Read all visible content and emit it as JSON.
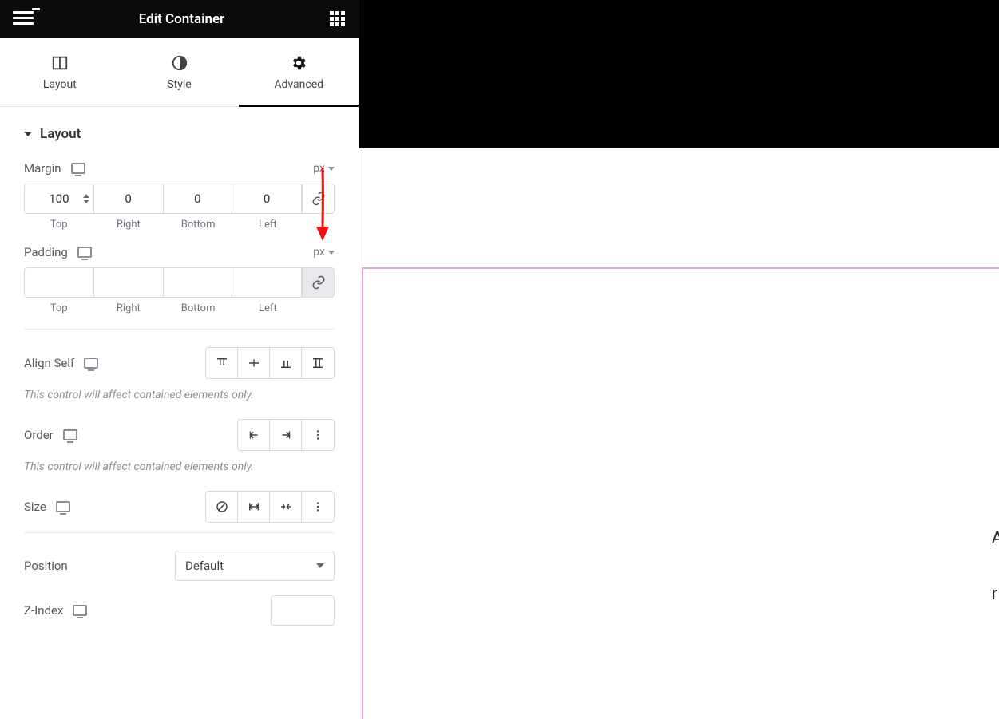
{
  "header": {
    "title": "Edit Container"
  },
  "tabs": {
    "layout": "Layout",
    "style": "Style",
    "advanced": "Advanced",
    "active": "advanced"
  },
  "section": {
    "layout_title": "Layout"
  },
  "margin": {
    "label": "Margin",
    "unit": "px",
    "top": "100",
    "right": "0",
    "bottom": "0",
    "left": "0",
    "sub": {
      "top": "Top",
      "right": "Right",
      "bottom": "Bottom",
      "left": "Left"
    }
  },
  "padding": {
    "label": "Padding",
    "unit": "px",
    "top": "",
    "right": "",
    "bottom": "",
    "left": "",
    "sub": {
      "top": "Top",
      "right": "Right",
      "bottom": "Bottom",
      "left": "Left"
    }
  },
  "alignSelf": {
    "label": "Align Self"
  },
  "notes": {
    "contained1": "This control will affect contained elements only.",
    "contained2": "This control will affect contained elements only."
  },
  "order": {
    "label": "Order"
  },
  "size": {
    "label": "Size"
  },
  "position": {
    "label": "Position",
    "value": "Default"
  },
  "zindex": {
    "label": "Z-Index",
    "value": ""
  },
  "preview": {
    "line1": "A",
    "line2": "r"
  }
}
